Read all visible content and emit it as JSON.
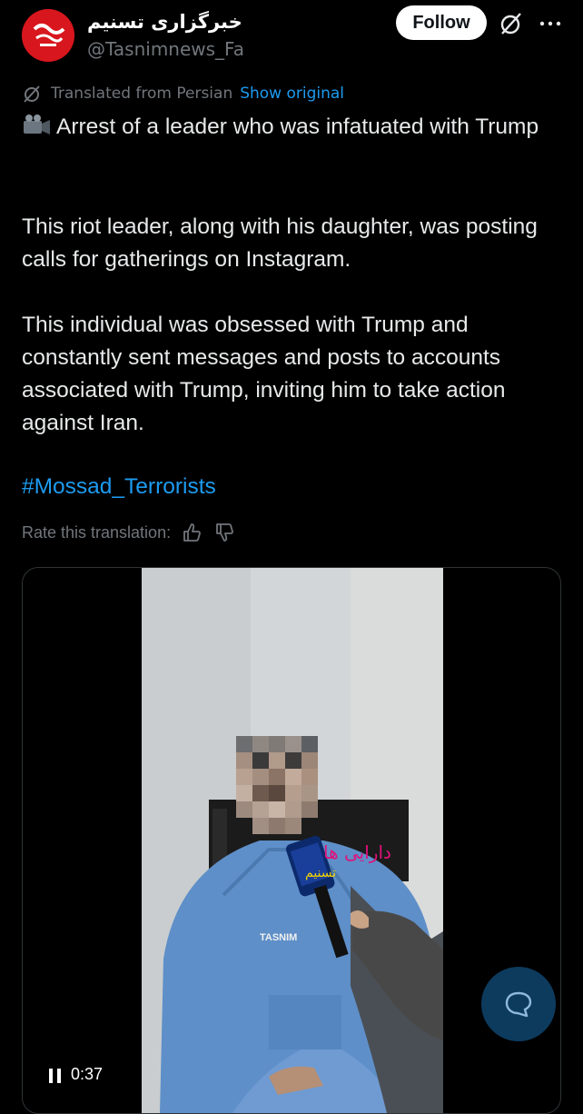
{
  "account": {
    "display_name": "خبرگزاری تسنیم",
    "handle": "@Tasnimnews_Fa",
    "follow_label": "Follow"
  },
  "translation": {
    "notice": "Translated from Persian",
    "show_original": "Show original",
    "rate_label": "Rate this translation:"
  },
  "tweet": {
    "line1": "Arrest of a leader who was infatuated with Trump",
    "paragraph2": "This riot leader, along with his daughter, was posting calls for gatherings on Instagram.",
    "paragraph3": "This individual was obsessed with Trump and constantly sent messages and posts to accounts associated with Trump, inviting him to take action against Iran.",
    "hashtag": "#Mossad_Terrorists"
  },
  "video": {
    "time": "0:37",
    "watermark": "TASNIM",
    "overlay_text": "دارایی ها",
    "mic_label": "تسنیم"
  },
  "icons": {
    "grok": "grok-icon",
    "more": "more-icon",
    "thumbs_up": "thumbs-up-icon",
    "thumbs_down": "thumbs-down-icon",
    "pause": "pause-icon",
    "chat": "chat-bubble-icon"
  },
  "colors": {
    "accent": "#1d9bf0",
    "background": "#000000",
    "text": "#e7e9ea",
    "muted": "#71767b"
  }
}
